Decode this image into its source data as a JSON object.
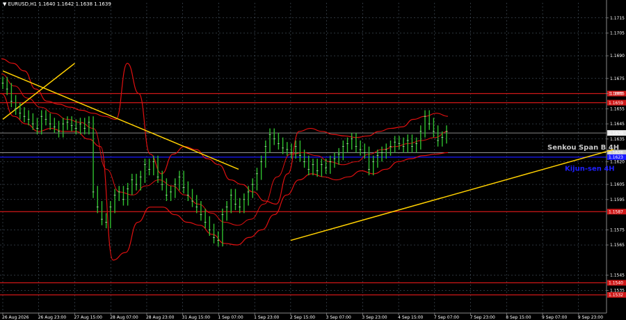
{
  "header": {
    "symbol_line": "▼ EURUSD,H1  1.1640 1.1642 1.1638 1.1639"
  },
  "chart_data": {
    "type": "line",
    "title": "",
    "symbol": "EURUSD,H1",
    "ohlc": {
      "open": 1.164,
      "high": 1.1642,
      "low": 1.1638,
      "close": 1.1639
    },
    "ylim": [
      1.152,
      1.1725
    ],
    "y_ticks": [
      "1.1715",
      "1.1705",
      "1.1690",
      "1.1675",
      "1.1665",
      "1.1655",
      "1.1645",
      "1.1635",
      "1.1620",
      "1.1605",
      "1.1595",
      "1.1575",
      "1.1565",
      "1.1545",
      "1.1535"
    ],
    "x_ticks": [
      "26 Aug 2026",
      "26 Aug 23:00",
      "27 Aug 15:00",
      "28 Aug 07:00",
      "28 Aug 23:00",
      "31 Aug 15:00",
      "1 Sep 07:00",
      "1 Sep 23:00",
      "2 Sep 15:00",
      "3 Sep 07:00",
      "3 Sep 23:00",
      "4 Sep 15:00",
      "7 Sep 07:00",
      "7 Sep 23:00",
      "8 Sep 15:00",
      "9 Sep 07:00",
      "9 Sep 23:00"
    ],
    "series_color": "#2fbf2f",
    "price_series": [
      1.1672,
      1.1668,
      1.166,
      1.1655,
      1.1652,
      1.165,
      1.1648,
      1.1645,
      1.1642,
      1.165,
      1.1648,
      1.1645,
      1.1643,
      1.164,
      1.1645,
      1.1646,
      1.1644,
      1.1642,
      1.1645,
      1.1642,
      1.1646,
      1.16,
      1.159,
      1.1582,
      1.158,
      1.159,
      1.1598,
      1.16,
      1.1595,
      1.1602,
      1.1608,
      1.1605,
      1.161,
      1.1618,
      1.1615,
      1.162,
      1.161,
      1.1605,
      1.1598,
      1.16,
      1.1605,
      1.161,
      1.1603,
      1.1598,
      1.1594,
      1.159,
      1.1585,
      1.158,
      1.1575,
      1.157,
      1.1568,
      1.1585,
      1.159,
      1.1598,
      1.1592,
      1.159,
      1.1595,
      1.16,
      1.1605,
      1.1612,
      1.162,
      1.163,
      1.1638,
      1.1635,
      1.1632,
      1.1629,
      1.1628,
      1.1626,
      1.163,
      1.1624,
      1.162,
      1.1615,
      1.1618,
      1.1614,
      1.1618,
      1.1616,
      1.162,
      1.1622,
      1.1625,
      1.163,
      1.1632,
      1.1635,
      1.163,
      1.1628,
      1.1626,
      1.1615,
      1.162,
      1.1624,
      1.1626,
      1.1628,
      1.163,
      1.1633,
      1.1632,
      1.163,
      1.1634,
      1.163,
      1.1632,
      1.164,
      1.165,
      1.1645,
      1.164,
      1.1634,
      1.1636,
      1.164
    ],
    "bands": {
      "color": "#e01010",
      "upper": [
        1.1688,
        1.1685,
        1.168,
        1.1668,
        1.166,
        1.1658,
        1.1656,
        1.1654,
        1.1652,
        1.165,
        1.1648,
        1.1685,
        1.1665,
        1.1625,
        1.1612,
        1.1625,
        1.163,
        1.1628,
        1.1622,
        1.1618,
        1.1608,
        1.1605,
        1.16,
        1.1594,
        1.1592,
        1.1612,
        1.164,
        1.1642,
        1.164,
        1.1638,
        1.1637,
        1.1636,
        1.1637,
        1.164,
        1.1642,
        1.1643,
        1.1648,
        1.165,
        1.1652,
        1.165
      ],
      "lower": [
        1.1665,
        1.165,
        1.1645,
        1.164,
        1.1642,
        1.164,
        1.164,
        1.1635,
        1.163,
        1.1555,
        1.156,
        1.158,
        1.159,
        1.159,
        1.1585,
        1.158,
        1.1578,
        1.1572,
        1.1566,
        1.1565,
        1.157,
        1.1575,
        1.1585,
        1.1598,
        1.1608,
        1.1612,
        1.161,
        1.1608,
        1.161,
        1.1614,
        1.1612,
        1.1615,
        1.162,
        1.1622,
        1.1624,
        1.1625,
        1.1626
      ],
      "middle": [
        1.1678,
        1.167,
        1.1662,
        1.1656,
        1.1652,
        1.1648,
        1.1646,
        1.1642,
        1.1615,
        1.16,
        1.1598,
        1.1604,
        1.1608,
        1.1604,
        1.1598,
        1.1592,
        1.1586,
        1.158,
        1.1578,
        1.1582,
        1.1592,
        1.161,
        1.1625,
        1.1626,
        1.1624,
        1.162,
        1.1618,
        1.162,
        1.1625,
        1.1628,
        1.163,
        1.1632,
        1.1634,
        1.1636,
        1.164
      ]
    },
    "horizontal_levels": [
      {
        "price": 1.1665,
        "label": "1.1665",
        "color": "#d01818",
        "style": "solid"
      },
      {
        "price": 1.1659,
        "label": "1.1659",
        "color": "#d01818",
        "style": "solid"
      },
      {
        "price": 1.1639,
        "label": "1.1639",
        "color": "#b0b0b0",
        "style": "thin",
        "current": true
      },
      {
        "price": 1.1626,
        "label": "1.1626",
        "color": "#c8c8c8",
        "style": "thin"
      },
      {
        "price": 1.1623,
        "label": "1.1623",
        "color": "#1818ff",
        "style": "solid"
      },
      {
        "price": 1.1587,
        "label": "1.1587",
        "color": "#d01818",
        "style": "solid"
      },
      {
        "price": 1.154,
        "label": "1.1540",
        "color": "#d01818",
        "style": "solid"
      },
      {
        "price": 1.1532,
        "label": "1.1532",
        "color": "#d01818",
        "style": "solid"
      }
    ],
    "annotations": [
      {
        "text": "Senkou Span B 4H",
        "color": "#c8c8c8"
      },
      {
        "text": "Kijun-sen 4H",
        "color": "#1e1eff"
      }
    ],
    "trendlines": {
      "color": "#ffd000",
      "lines": [
        {
          "from": [
            "26 Aug 2026",
            1.168
          ],
          "to": [
            "2 Sep 15:00",
            1.1615
          ]
        },
        {
          "from": [
            "26 Aug 2026",
            1.1648
          ],
          "to": [
            "27 Aug 15:00",
            1.1685
          ]
        },
        {
          "from": [
            "2 Sep 15:00",
            1.1568
          ],
          "to": [
            "9 Sep 23:00",
            1.1628
          ]
        }
      ]
    },
    "grid": true,
    "legend": "none"
  }
}
